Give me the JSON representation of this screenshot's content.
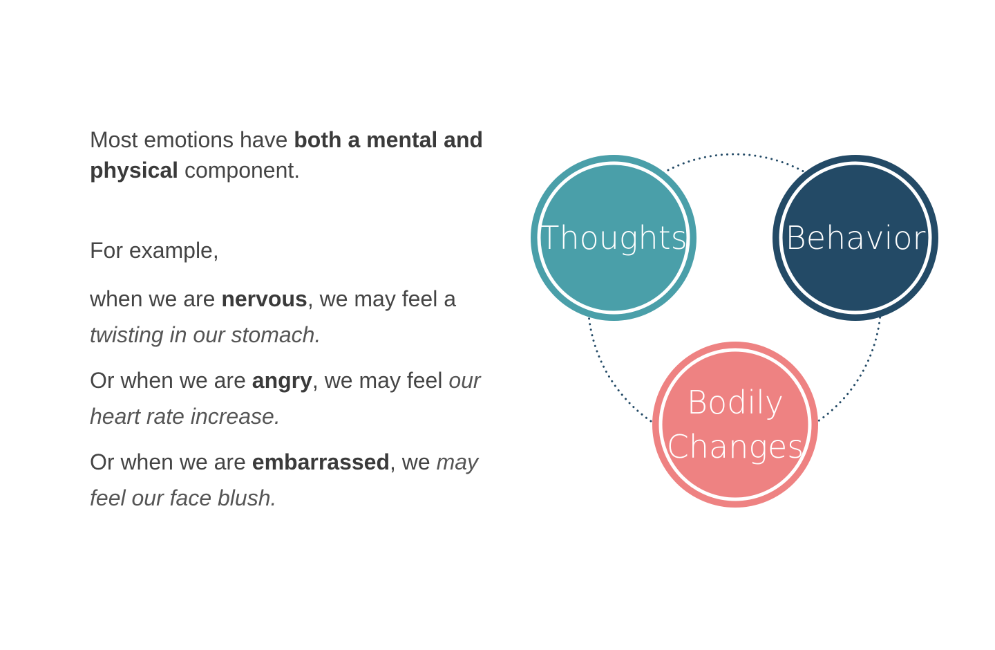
{
  "intro": {
    "prefix": "Most emotions have ",
    "bold": "both a mental and physical",
    "suffix": " component."
  },
  "for_example": "For example,",
  "examples": [
    {
      "lead": "when we are ",
      "emotion": "nervous",
      "mid": ", we may feel a ",
      "effect": "twisting in our stomach."
    },
    {
      "lead": "Or when we are ",
      "emotion": "angry",
      "mid": ", we may feel ",
      "effect": "our heart rate increase."
    },
    {
      "lead": "Or when we are ",
      "emotion": "embarrassed",
      "mid": ", we ",
      "effect": "may feel our face blush."
    }
  ],
  "diagram": {
    "nodes": [
      {
        "label_lines": [
          "Thoughts"
        ],
        "color": "#4a9fa9"
      },
      {
        "label_lines": [
          "Behavior"
        ],
        "color": "#234a66"
      },
      {
        "label_lines": [
          "Bodily",
          "Changes"
        ],
        "color": "#ee8282"
      }
    ],
    "connector_color": "#234a66"
  }
}
